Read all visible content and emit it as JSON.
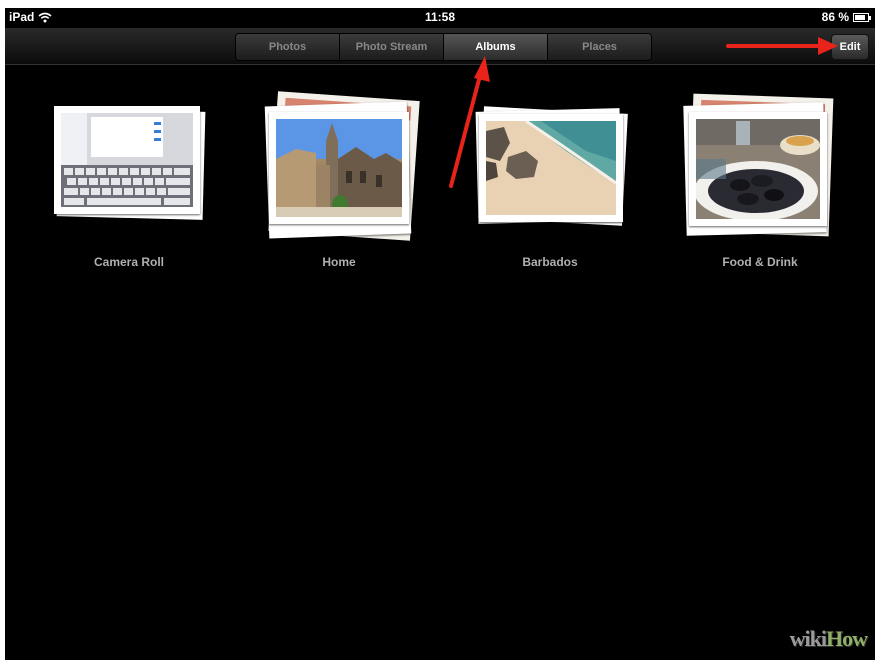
{
  "status_bar": {
    "device": "iPad",
    "time": "11:58",
    "battery": "86 %",
    "battery_level": 0.86
  },
  "nav": {
    "tabs": [
      {
        "label": "Photos",
        "active": false
      },
      {
        "label": "Photo Stream",
        "active": false
      },
      {
        "label": "Albums",
        "active": true
      },
      {
        "label": "Places",
        "active": false
      }
    ],
    "edit_label": "Edit"
  },
  "albums": [
    {
      "name": "Camera Roll"
    },
    {
      "name": "Home"
    },
    {
      "name": "Barbados"
    },
    {
      "name": "Food & Drink"
    }
  ],
  "watermark": {
    "wiki": "wiki",
    "how": "How"
  },
  "colors": {
    "arrow": "#e8231a",
    "active_tab": "#ffffff",
    "inactive_tab": "#888888",
    "label": "#b0b0b0"
  }
}
